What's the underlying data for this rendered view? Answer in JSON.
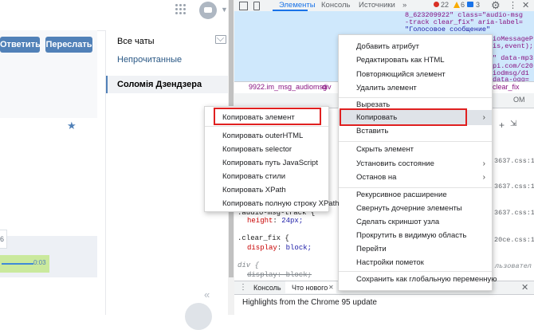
{
  "vk": {
    "reply_button": "Ответить",
    "forward_button": "Переслать",
    "sidebar": {
      "all_chats": "Все чаты",
      "unread": "Непрочитанные",
      "selected_chat": "Соломія Дзендзера"
    },
    "date_fragment": "6",
    "audio_time": "0:03"
  },
  "devtools": {
    "tabs": {
      "elements": "Элементы",
      "console": "Консоль",
      "sources": "Источники",
      "more": "»"
    },
    "counts": {
      "errors": "22",
      "warnings": "6",
      "messages": "3"
    },
    "dom_lines": [
      "8_623209922\" class=\"audio-msg",
      "-track clear_fix\" aria-label=",
      "\"Голосовое сообщение\"",
      "ioMessageP",
      "is,event);",
      "\" data-mp3",
      "pi.com/c20",
      "iodmsg/d1",
      "data-ogg="
    ],
    "crumbs": [
      "9922.im_msg_audiomsg",
      "div"
    ],
    "crumb_right": "clear_fix",
    "styles_tab": "OM",
    "css_sources": [
      "3637.css:1",
      "3637.css:1",
      "3637.css:1",
      "20ce.css:1"
    ],
    "css_rules": {
      "audio_msg_track_selector": ".audio-msg-track {",
      "height_prop": "height",
      "height_val": "24px;",
      "clear_fix_selector": ".clear_fix {",
      "display_prop": "display",
      "display_val": "block;",
      "div_selector": "div {",
      "display_block_struck": "display: block;",
      "ua_note": "льзовател"
    },
    "drawer": {
      "console_tab": "Консоль",
      "whats_new_tab": "Что нового",
      "highlights": "Highlights from the Chrome 95 update"
    }
  },
  "context_menu_main": {
    "items": [
      "Добавить атрибут",
      "Редактировать как HTML",
      "Повторяющийся элемент",
      "Удалить элемент",
      "Вырезать",
      "Копировать",
      "Вставить",
      "Скрыть элемент",
      "Установить состояние",
      "Останов на",
      "Рекурсивное расширение",
      "Свернуть дочерние элементы",
      "Сделать скриншот узла",
      "Прокрутить в видимую область",
      "Перейти",
      "Настройки пометок",
      "Сохранить как глобальную переменную"
    ],
    "arrow": "›"
  },
  "context_menu_copy": {
    "items": [
      "Копировать элемент",
      "Копировать outerHTML",
      "Копировать selector",
      "Копировать путь JavaScript",
      "Копировать стили",
      "Копировать XPath",
      "Копировать полную строку XPath"
    ]
  }
}
